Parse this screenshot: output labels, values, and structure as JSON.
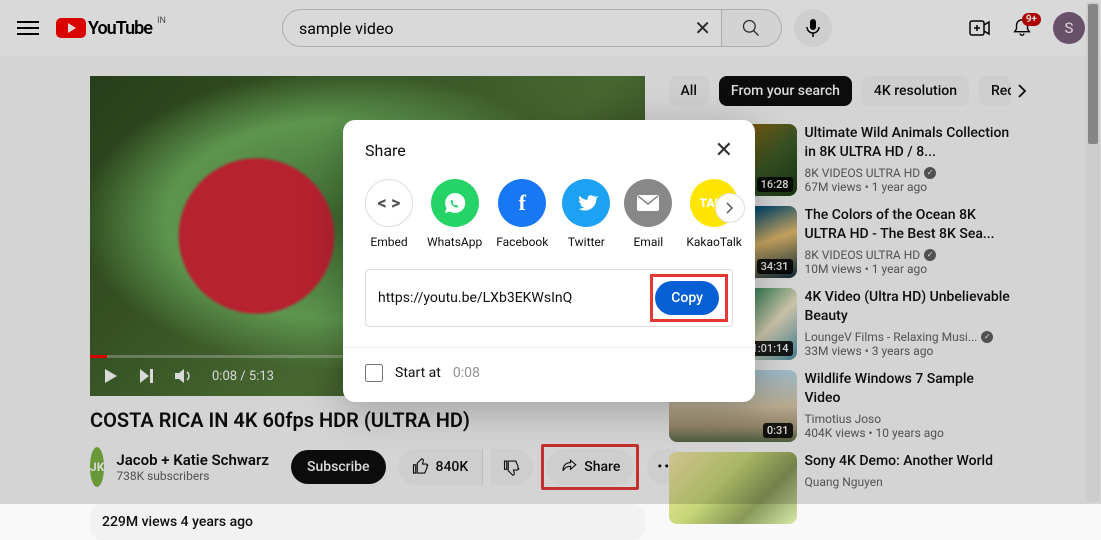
{
  "header": {
    "logo_text": "YouTube",
    "country": "IN",
    "search_value": "sample video",
    "bell_badge": "9+",
    "avatar_letter": "S"
  },
  "player": {
    "current_time": "0:08",
    "duration": "5:13"
  },
  "video": {
    "title": "COSTA RICA IN 4K 60fps HDR (ULTRA HD)",
    "channel_name": "Jacob + Katie Schwarz",
    "channel_avatar_letter": "JK",
    "subscribers": "738K subscribers",
    "subscribe_label": "Subscribe",
    "likes": "840K",
    "share_label": "Share",
    "description_meta": "229M views  4 years ago"
  },
  "chips": [
    {
      "label": "All"
    },
    {
      "label": "From your search"
    },
    {
      "label": "4K resolution"
    },
    {
      "label": "Rec"
    }
  ],
  "recommendations": [
    {
      "title": "Ultimate Wild Animals Collection in 8K ULTRA HD / 8...",
      "channel": "8K VIDEOS ULTRA HD",
      "verified": true,
      "views": "67M views",
      "age": "1 year ago",
      "duration": "16:28"
    },
    {
      "title": "The Colors of the Ocean 8K ULTRA HD - The Best 8K Sea...",
      "channel": "8K VIDEOS ULTRA HD",
      "verified": true,
      "views": "10M views",
      "age": "1 year ago",
      "duration": "34:31"
    },
    {
      "title": "4K Video (Ultra HD) Unbelievable Beauty",
      "channel": "LoungeV Films - Relaxing Musi...",
      "verified": true,
      "views": "33M views",
      "age": "3 years ago",
      "duration": "1:01:14"
    },
    {
      "title": "Wildlife Windows 7 Sample Video",
      "channel": "Timotius Joso",
      "verified": false,
      "views": "404K views",
      "age": "10 years ago",
      "duration": "0:31"
    },
    {
      "title": "Sony 4K Demo: Another World",
      "channel": "Quang Nguyen",
      "verified": false,
      "views": "",
      "age": "",
      "duration": ""
    }
  ],
  "share_dialog": {
    "title": "Share",
    "targets": [
      {
        "key": "embed",
        "label": "Embed"
      },
      {
        "key": "whatsapp",
        "label": "WhatsApp"
      },
      {
        "key": "facebook",
        "label": "Facebook"
      },
      {
        "key": "twitter",
        "label": "Twitter"
      },
      {
        "key": "email",
        "label": "Email"
      },
      {
        "key": "kakaotalk",
        "label": "KakaoTalk"
      }
    ],
    "url": "https://youtu.be/LXb3EKWsInQ",
    "copy_label": "Copy",
    "start_at_label": "Start at",
    "start_at_time": "0:08"
  }
}
